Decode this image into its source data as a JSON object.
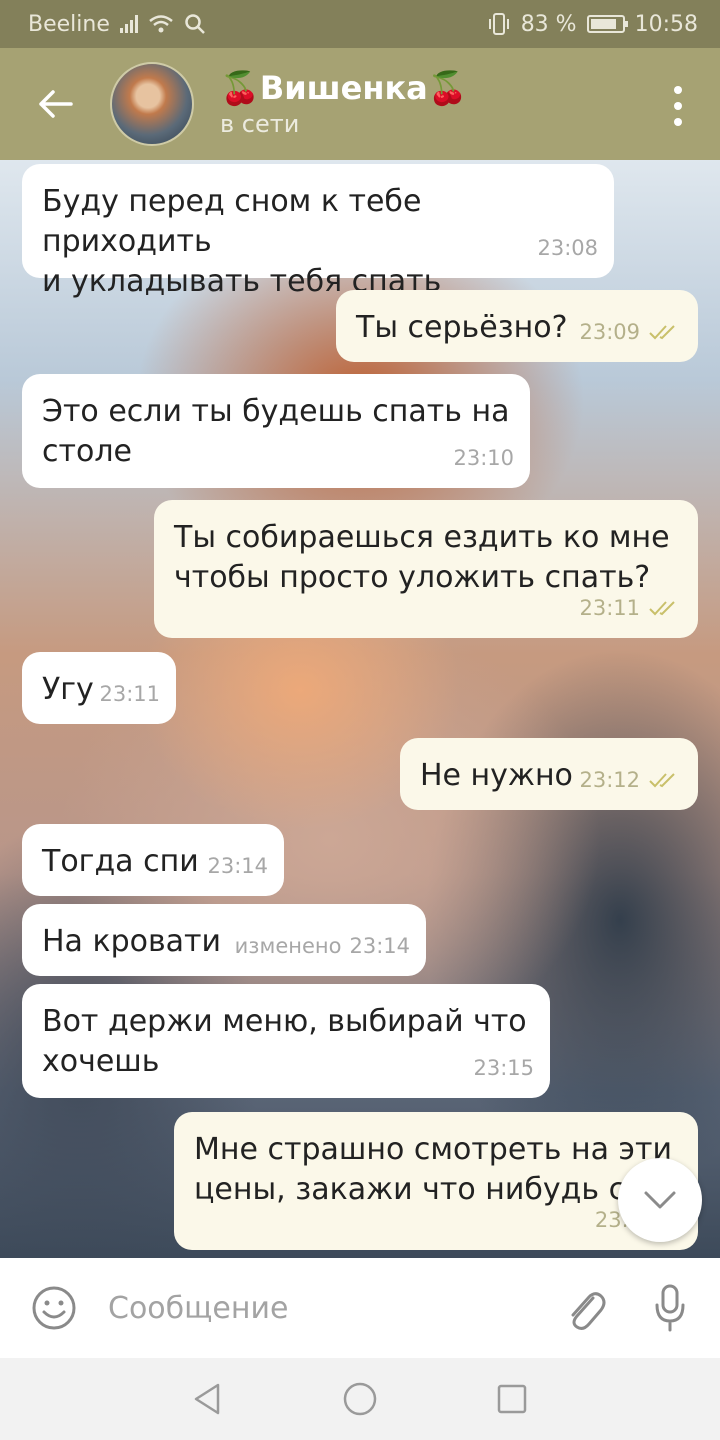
{
  "status_bar": {
    "carrier": "Beeline",
    "battery_percent": "83 %",
    "battery_level": 0.83,
    "time": "10:58",
    "icons": [
      "signal-icon",
      "wifi-icon",
      "search-icon",
      "vibrate-icon",
      "battery-icon"
    ]
  },
  "header": {
    "title": "🍒Вишенка🍒",
    "status": "в сети",
    "icons": [
      "back-arrow-icon",
      "more-vertical-icon"
    ]
  },
  "messages": [
    {
      "dir": "in",
      "text": "Буду перед сном к тебе приходить\nи укладывать тебя спать",
      "time": "23:08",
      "meta_prefix": ""
    },
    {
      "dir": "out",
      "text": "Ты серьёзно?",
      "time": "23:09",
      "meta_prefix": "",
      "read": true
    },
    {
      "dir": "in",
      "text": "Это если ты будешь спать на\nстоле",
      "time": "23:10",
      "meta_prefix": ""
    },
    {
      "dir": "out",
      "text": "Ты собираешься ездить ко мне\nчтобы просто уложить спать?",
      "time": "23:11",
      "meta_prefix": "",
      "read": true
    },
    {
      "dir": "in",
      "text": "Угу",
      "time": "23:11",
      "meta_prefix": ""
    },
    {
      "dir": "out",
      "text": "Не нужно",
      "time": "23:12",
      "meta_prefix": "",
      "read": true
    },
    {
      "dir": "in",
      "text": "Тогда спи",
      "time": "23:14",
      "meta_prefix": ""
    },
    {
      "dir": "in",
      "text": "На кровати",
      "time": "23:14",
      "meta_prefix": "изменено"
    },
    {
      "dir": "in",
      "text": "Вот держи меню, выбирай что\nхочешь",
      "time": "23:15",
      "meta_prefix": ""
    },
    {
      "dir": "out",
      "text": "Мне страшно смотреть на эти\nцены, закажи что нибудь с",
      "time": "23:1",
      "meta_prefix": ""
    }
  ],
  "input": {
    "placeholder": "Сообщение",
    "icons": [
      "emoji-icon",
      "attach-icon",
      "mic-icon"
    ]
  },
  "scroll_down": {
    "icon": "chevron-down-icon"
  },
  "nav_bar": {
    "icons": [
      "nav-back-icon",
      "nav-home-icon",
      "nav-recents-icon"
    ]
  },
  "colors": {
    "status_bar": "#83805a",
    "header": "#a6a273",
    "incoming_bubble": "#ffffff",
    "outgoing_bubble": "#fbf8e9",
    "read_ticks": "#c9c06a"
  }
}
